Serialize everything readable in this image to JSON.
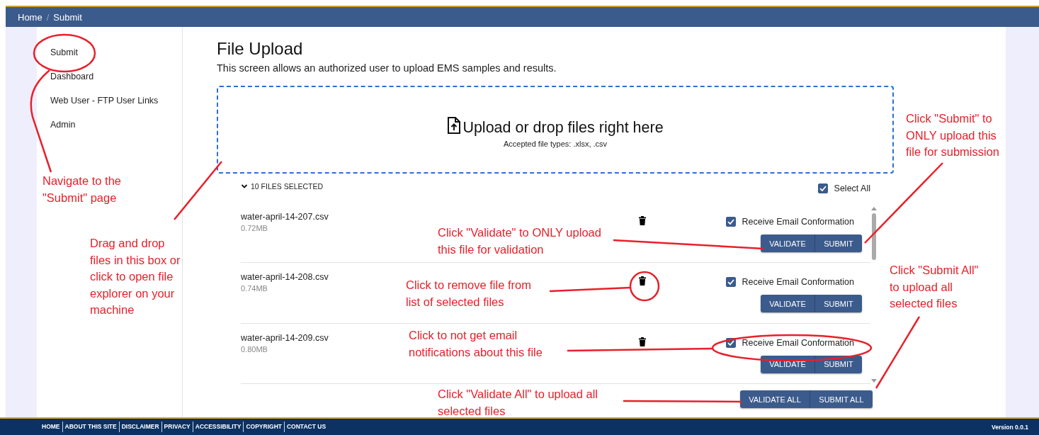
{
  "breadcrumb": {
    "items": [
      "Home",
      "Submit"
    ],
    "separator": "/"
  },
  "sidebar": {
    "items": [
      {
        "label": "Submit"
      },
      {
        "label": "Dashboard"
      },
      {
        "label": "Web User - FTP User Links"
      },
      {
        "label": "Admin"
      }
    ]
  },
  "page": {
    "title": "File Upload",
    "description": "This screen allows an authorized user to upload EMS samples and results."
  },
  "dropzone": {
    "prompt": "Upload or drop files right here",
    "accepted": "Accepted file types: .xlsx, .csv"
  },
  "file_list": {
    "summary": "10 FILES SELECTED",
    "expanded": true,
    "select_all": {
      "label": "Select All",
      "checked": true
    },
    "files": [
      {
        "name": "water-april-14-207.csv",
        "size": "0.72MB",
        "email_label": "Receive Email Conformation",
        "email_checked": true,
        "actions": [
          "VALIDATE",
          "SUBMIT"
        ]
      },
      {
        "name": "water-april-14-208.csv",
        "size": "0.74MB",
        "email_label": "Receive Email Conformation",
        "email_checked": true,
        "actions": [
          "VALIDATE",
          "SUBMIT"
        ]
      },
      {
        "name": "water-april-14-209.csv",
        "size": "0.80MB",
        "email_label": "Receive Email Conformation",
        "email_checked": true,
        "actions": [
          "VALIDATE",
          "SUBMIT"
        ]
      }
    ],
    "bulk_actions": [
      "VALIDATE ALL",
      "SUBMIT ALL"
    ]
  },
  "footer": {
    "links": [
      "HOME",
      "ABOUT THIS SITE",
      "DISCLAIMER",
      "PRIVACY",
      "ACCESSIBILITY",
      "COPYRIGHT",
      "CONTACT US"
    ],
    "version": "Version 0.0.1"
  },
  "annotations": [
    {
      "text": "Navigate to the\n\"Submit\" page"
    },
    {
      "text": "Drag and drop\nfiles in this box or\nclick to open file\nexplorer on your\nmachine"
    },
    {
      "text": "Click \"Validate\" to ONLY upload\nthis file for validation"
    },
    {
      "text": "Click to remove file from\nlist of selected files"
    },
    {
      "text": "Click to not get email\nnotifications about this file"
    },
    {
      "text": "Click \"Validate All\" to upload all\nselected files"
    },
    {
      "text": "Click \"Submit\" to\nONLY upload this\nfile for submission"
    },
    {
      "text": "Click \"Submit All\"\nto upload all\nselected files"
    }
  ]
}
